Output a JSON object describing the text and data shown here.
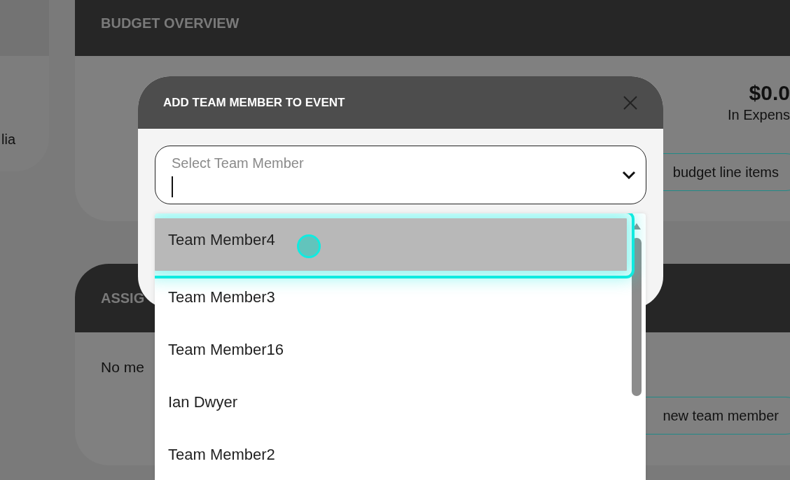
{
  "background": {
    "left_card": {
      "text": "lia"
    },
    "budget": {
      "title": "BUDGET OVERVIEW",
      "amount": "$0.0",
      "amount_label": "In Expens",
      "button": "budget line items"
    },
    "assigned": {
      "title": "ASSIG",
      "empty_text": "No me",
      "button": "new team member"
    }
  },
  "modal": {
    "title": "ADD TEAM MEMBER TO EVENT",
    "field": {
      "label": "Select Team Member"
    },
    "options": [
      {
        "label": "Team Member4",
        "selected": true
      },
      {
        "label": "Team Member3",
        "selected": false
      },
      {
        "label": "Team Member16",
        "selected": false
      },
      {
        "label": "Ian Dwyer",
        "selected": false
      },
      {
        "label": "Team Member2",
        "selected": false
      }
    ]
  }
}
